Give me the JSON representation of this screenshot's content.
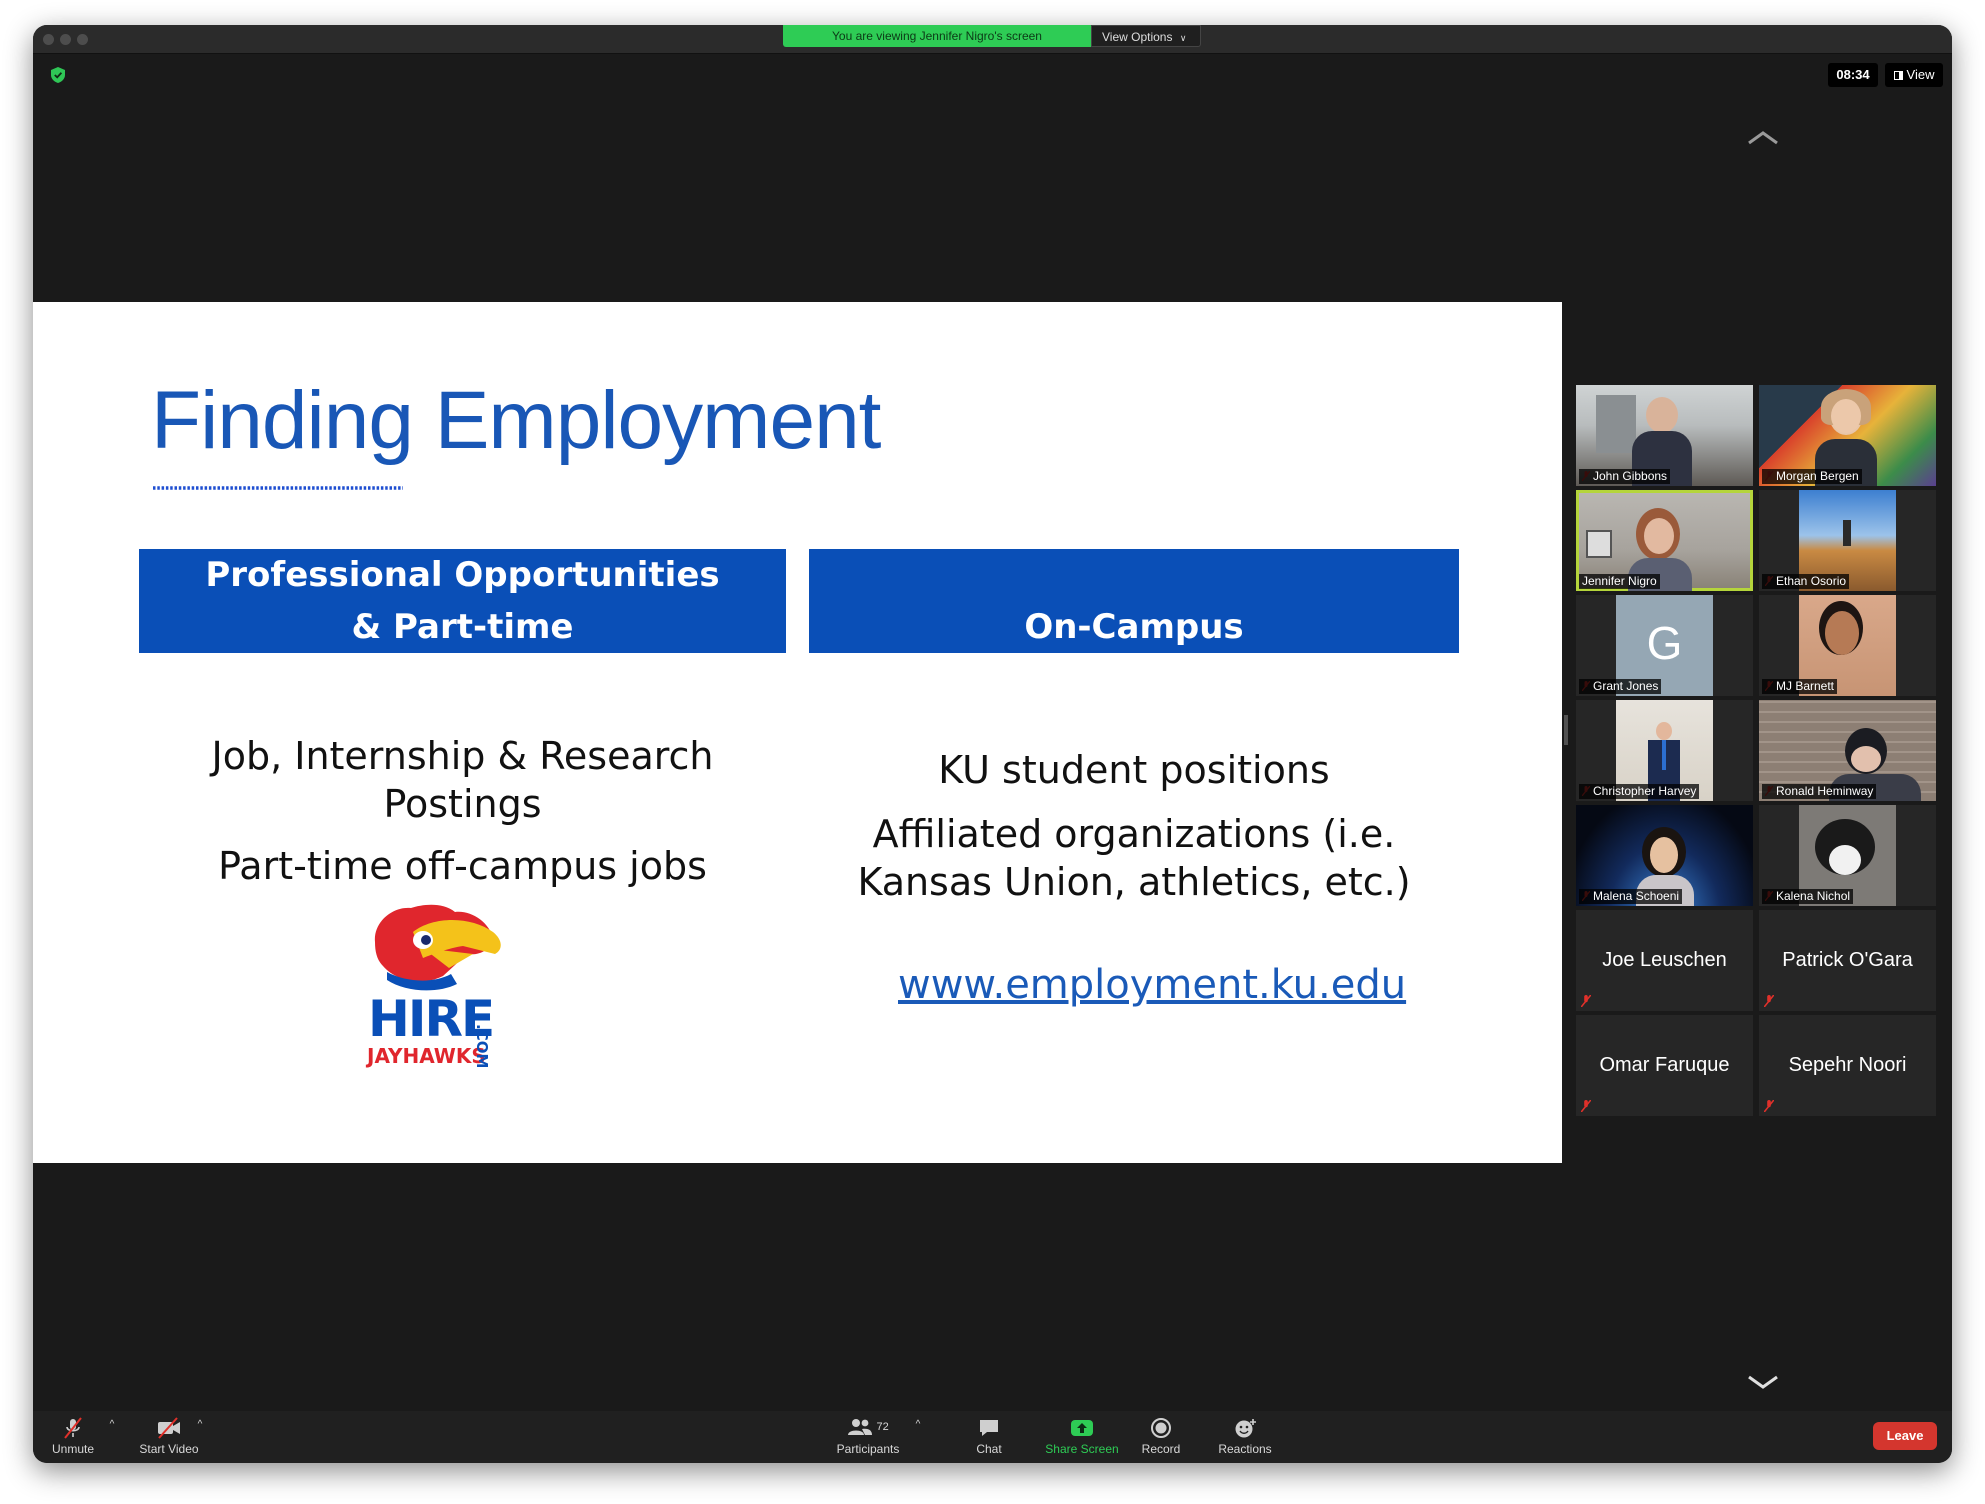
{
  "banner": {
    "viewing_text": "You are viewing Jennifer Nigro's screen",
    "view_options_label": "View Options"
  },
  "top_right": {
    "clock": "08:34",
    "view_label": "View"
  },
  "slide": {
    "title": "Finding Employment",
    "left_header_line1": "Professional Opportunities",
    "left_header_line2": "& Part-time",
    "right_header": "On-Campus",
    "left_body": {
      "line1": "Job, Internship & Research",
      "line2": "Postings",
      "line3": "Part-time off-campus jobs"
    },
    "right_body": {
      "line1": "KU student positions",
      "line2": "Affiliated organizations (i.e.",
      "line3": "Kansas Union, athletics, etc.)"
    },
    "url": "www.employment.ku.edu",
    "logo": {
      "word1": "HIRE",
      "word2": "JAYHAWKS",
      "word3": ".COM"
    }
  },
  "participants": [
    {
      "name": "John Gibbons",
      "kind": "video"
    },
    {
      "name": "Morgan Bergen",
      "kind": "video"
    },
    {
      "name": "Jennifer Nigro",
      "kind": "video",
      "active_speaker": true
    },
    {
      "name": "Ethan Osorio",
      "kind": "video"
    },
    {
      "name": "Grant Jones",
      "kind": "avatar",
      "initial": "G"
    },
    {
      "name": "MJ Barnett",
      "kind": "video"
    },
    {
      "name": "Christopher Harvey",
      "kind": "video"
    },
    {
      "name": "Ronald Heminway",
      "kind": "video"
    },
    {
      "name": "Malena Schoeni",
      "kind": "video"
    },
    {
      "name": "Kalena Nichol",
      "kind": "video"
    },
    {
      "name": "Joe Leuschen",
      "kind": "name-only"
    },
    {
      "name": "Patrick O'Gara",
      "kind": "name-only"
    },
    {
      "name": "Omar Faruque",
      "kind": "name-only"
    },
    {
      "name": "Sepehr Noori",
      "kind": "name-only"
    }
  ],
  "toolbar": {
    "unmute": "Unmute",
    "start_video": "Start Video",
    "participants": "Participants",
    "participants_count": "72",
    "chat": "Chat",
    "share_screen": "Share Screen",
    "record": "Record",
    "reactions": "Reactions",
    "leave": "Leave"
  },
  "colors": {
    "slide_blue": "#0a4fb7",
    "title_blue": "#1957b6",
    "share_green": "#2ecc55",
    "leave_red": "#d4362e",
    "active_outline": "#b5d53b",
    "muted_red": "#e0302a"
  }
}
